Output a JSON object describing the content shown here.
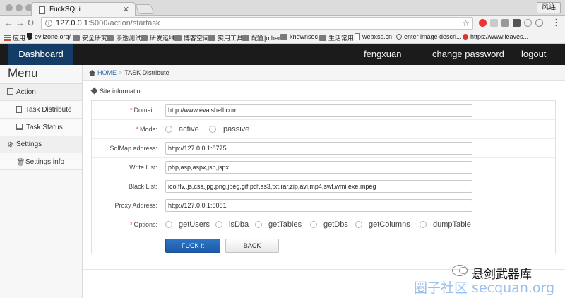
{
  "browser": {
    "tab_title": "FuckSQLi",
    "window_button": "风连",
    "url_host": "127.0.0.1",
    "url_rest": ":5000/action/startask",
    "bookmarks": [
      "应用",
      "evilzone.org/",
      "安全研究",
      "渗透测试",
      "研发运维",
      "博客空间",
      "实用工具",
      "配置|other",
      "knownsec",
      "生活常用",
      "webxss.cn",
      "enter image descri...",
      "https://www.leaves..."
    ]
  },
  "navbar": {
    "brand": "Dashboard",
    "user": "fengxuan",
    "change_password": "change password",
    "logout": "logout"
  },
  "sidebar": {
    "title": "Menu",
    "sections": [
      {
        "label": "Action",
        "items": [
          "Task Distribute",
          "Task Status"
        ]
      },
      {
        "label": "Settings",
        "items": [
          "Settings info"
        ]
      }
    ]
  },
  "breadcrumb": {
    "home": "HOME",
    "separator": ">",
    "current": "TASK Distribute"
  },
  "section_title": "Site information",
  "form": {
    "domain": {
      "label": "Domain:",
      "value": "http://www.evalshell.com"
    },
    "mode": {
      "label": "Mode:",
      "options": [
        "active",
        "passive"
      ]
    },
    "sqlmap_address": {
      "label": "SqlMap address:",
      "value": "http://127.0.0.1:8775"
    },
    "write_list": {
      "label": "Write List:",
      "value": "php,asp,aspx,jsp,jspx"
    },
    "black_list": {
      "label": "Black List:",
      "value": "ico,flv,.js,css,jpg,png,jpeg,gif,pdf,ss3,txt,rar,zip,avi,mp4,swf,wmi,exe,mpeg"
    },
    "proxy_address": {
      "label": "Proxy Address:",
      "value": "http://127.0.0.1:8081"
    },
    "options": {
      "label": "Options:",
      "items": [
        "getUsers",
        "isDba",
        "getTables",
        "getDbs",
        "getColumns",
        "dumpTable"
      ]
    },
    "submit": "FUCK It",
    "back": "BACK"
  },
  "watermark": {
    "title": "悬剑武器库",
    "subtitle": "圈子社区 secquan.org"
  },
  "colors": {
    "navbar": "#1b1b1b",
    "brand": "#133d66",
    "primary_button": "#1d5ba8",
    "required": "#e04b3b",
    "link": "#2f6fa8"
  }
}
